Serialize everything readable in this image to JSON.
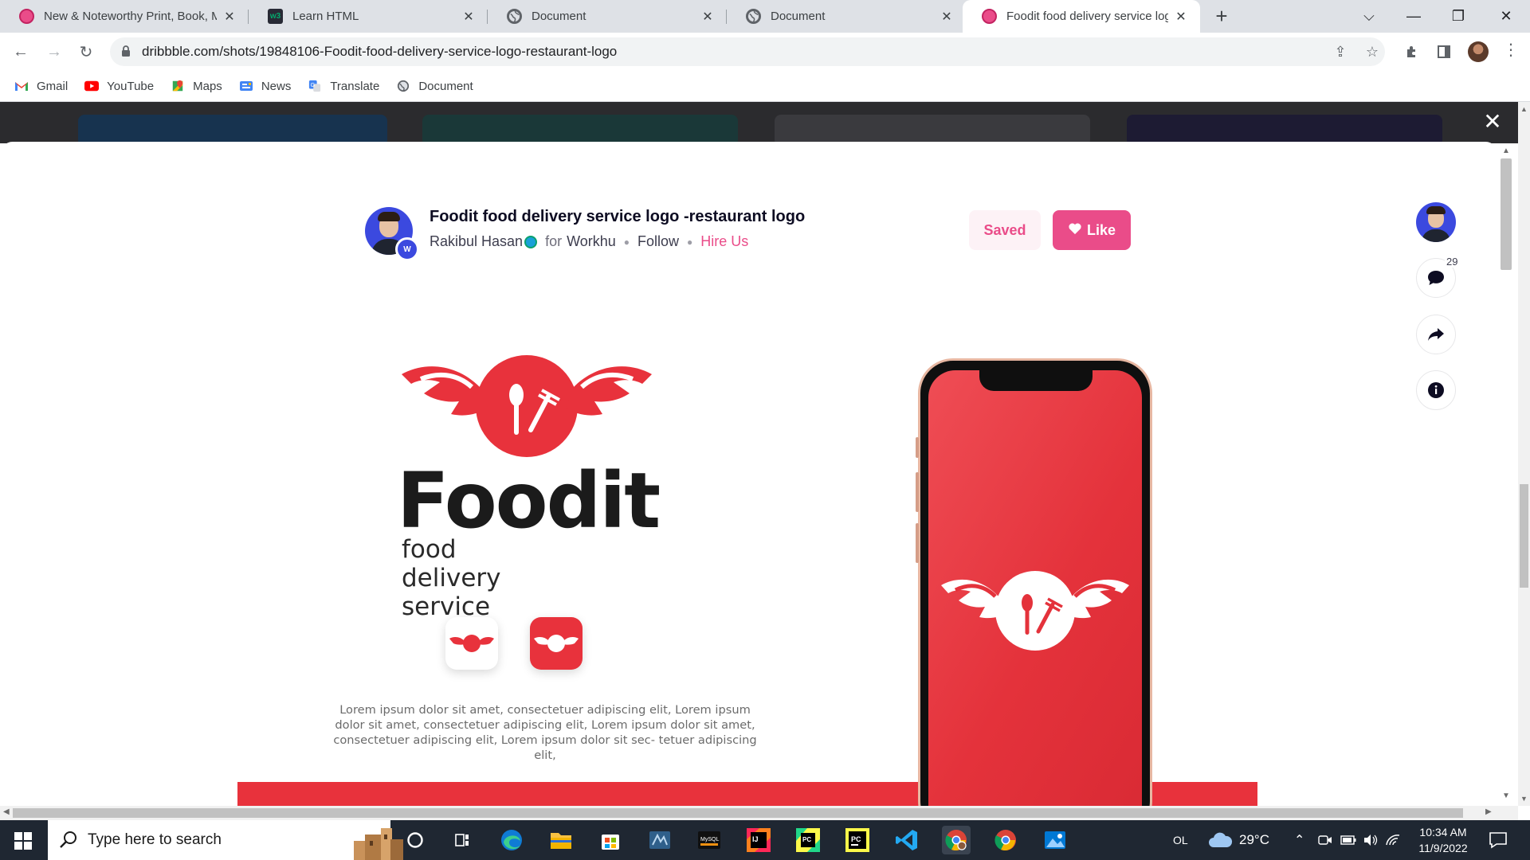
{
  "browser": {
    "tabs": [
      {
        "title": "New & Noteworthy Print, Book, M",
        "favicon": "dribbble-icon",
        "active": false
      },
      {
        "title": "Learn HTML",
        "favicon": "w3schools-icon",
        "active": false
      },
      {
        "title": "Document",
        "favicon": "globe-icon",
        "active": false
      },
      {
        "title": "Document",
        "favicon": "globe-icon",
        "active": false
      },
      {
        "title": "Foodit food delivery service logo",
        "favicon": "dribbble-icon",
        "active": true
      }
    ],
    "url": "dribbble.com/shots/19848106-Foodit-food-delivery-service-logo-restaurant-logo",
    "bookmarks": [
      {
        "label": "Gmail",
        "color": "#ea4335"
      },
      {
        "label": "YouTube",
        "color": "#ff0000"
      },
      {
        "label": "Maps",
        "color": "#34a853"
      },
      {
        "label": "News",
        "color": "#4285f4"
      },
      {
        "label": "Translate",
        "color": "#4285f4"
      },
      {
        "label": "Document",
        "color": "#5f6368"
      }
    ]
  },
  "shot": {
    "title": "Foodit food delivery service logo -restaurant logo",
    "author": "Rakibul Hasan",
    "for_label": "for",
    "team": "Workhu",
    "team_badge": "W",
    "follow": "Follow",
    "hire": "Hire Us",
    "saved_label": "Saved",
    "like_label": "Like",
    "comment_count": "29"
  },
  "artwork": {
    "brand": "Foodit",
    "tagline": "food delivery service",
    "lorem": "Lorem ipsum dolor sit amet, consectetuer adipiscing elit, Lorem ipsum dolor sit amet, consectetuer adipiscing elit, Lorem ipsum dolor sit amet, consectetuer adipiscing elit, Lorem ipsum dolor sit sec- tetuer adipiscing elit,",
    "brand_color": "#e8323c"
  },
  "colors": {
    "accent": "#ea4c89",
    "taskbar": "#1f2732"
  },
  "taskbar": {
    "search_placeholder": "Type here to search",
    "apps": [
      "task-view-icon",
      "edge-icon",
      "file-explorer-icon",
      "store-icon",
      "mysql-workbench-icon",
      "mysql-icon",
      "intellij-icon",
      "pycharm-ce-icon",
      "pycharm-icon",
      "vscode-icon",
      "chrome-profile-icon",
      "chrome-icon",
      "photos-icon"
    ],
    "tray_label": "OL",
    "temperature": "29°C",
    "time": "10:34 AM",
    "date": "11/9/2022"
  }
}
